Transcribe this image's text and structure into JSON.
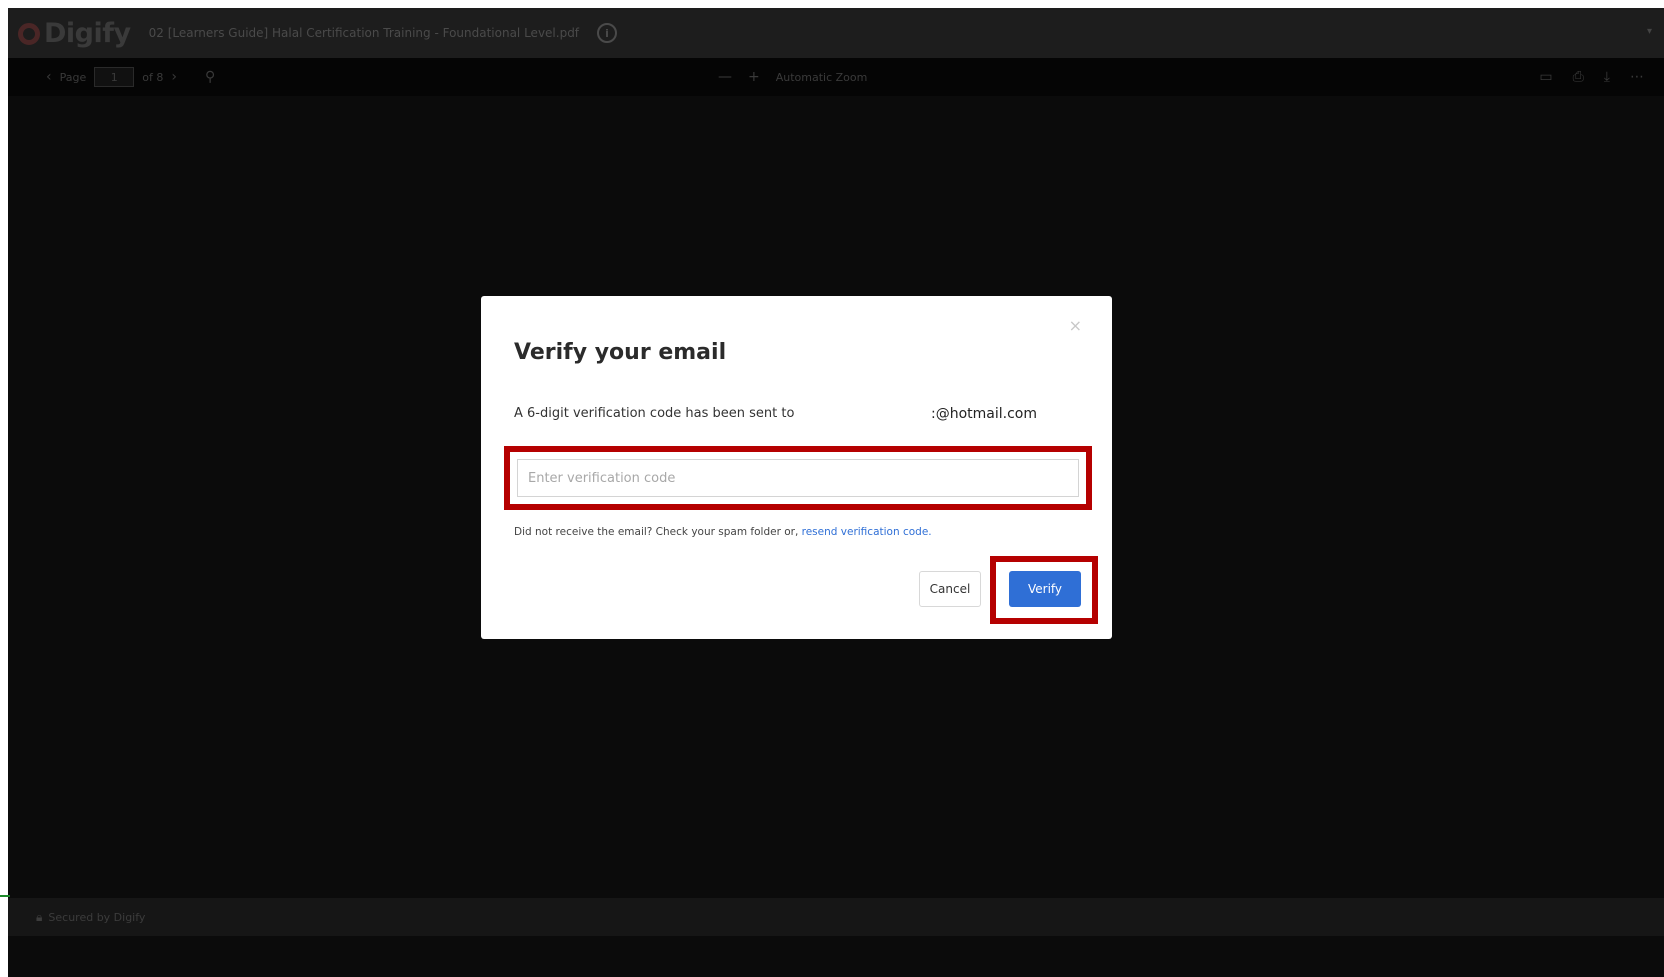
{
  "window": {
    "logo_text": "Digify",
    "document_title": "02 [Learners Guide] Halal Certification Training - Foundational Level.pdf",
    "info_icon": "info-icon"
  },
  "toolbar": {
    "page_label": "Page",
    "page_value": "1",
    "page_total": "of 8",
    "zoom_label": "Automatic Zoom"
  },
  "modal": {
    "title": "Verify your email",
    "sent_text": "A 6-digit verification code has been sent to",
    "email": ":@hotmail.com",
    "input_placeholder": "Enter verification code",
    "help_text": "Did not receive the email? Check your spam folder or, ",
    "resend_link": "resend verification code.",
    "cancel_label": "Cancel",
    "verify_label": "Verify",
    "close_symbol": "×"
  },
  "footer": {
    "secured_text": "Secured by Digify"
  },
  "colors": {
    "highlight": "#b50000",
    "primary": "#2f6fd6"
  }
}
